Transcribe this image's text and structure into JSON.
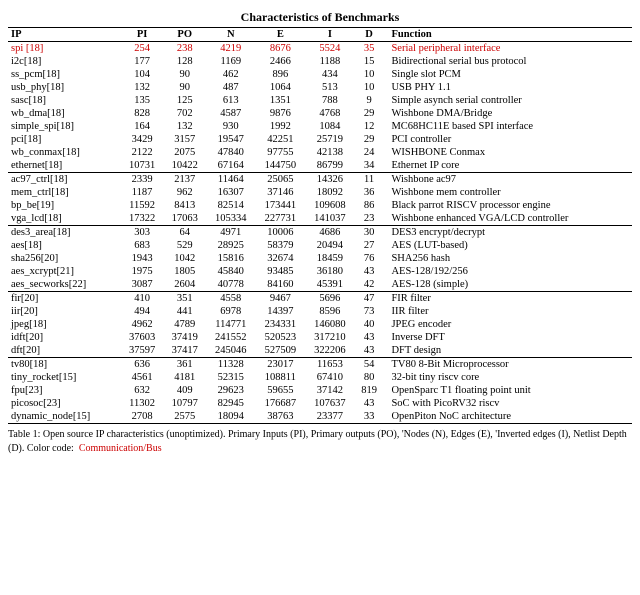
{
  "table": {
    "title": "Characteristics of Benchmarks",
    "headers": {
      "ip": "IP",
      "pi": "PI",
      "po": "PO",
      "n": "N",
      "e": "E",
      "i": "I",
      "d": "D",
      "function": "Function"
    },
    "groups": [
      {
        "rows": [
          {
            "ip": "spi [18]",
            "pi": "254",
            "po": "238",
            "n": "4219",
            "e": "8676",
            "i": "5524",
            "d": "35",
            "func": "Serial peripheral interface",
            "color": "comm"
          },
          {
            "ip": "i2c[18]",
            "pi": "177",
            "po": "128",
            "n": "1169",
            "e": "2466",
            "i": "1188",
            "d": "15",
            "func": "Bidirectional serial bus protocol",
            "color": ""
          },
          {
            "ip": "ss_pcm[18]",
            "pi": "104",
            "po": "90",
            "n": "462",
            "e": "896",
            "i": "434",
            "d": "10",
            "func": "Single slot PCM",
            "color": ""
          },
          {
            "ip": "usb_phy[18]",
            "pi": "132",
            "po": "90",
            "n": "487",
            "e": "1064",
            "i": "513",
            "d": "10",
            "func": "USB PHY 1.1",
            "color": ""
          },
          {
            "ip": "sasc[18]",
            "pi": "135",
            "po": "125",
            "n": "613",
            "e": "1351",
            "i": "788",
            "d": "9",
            "func": "Simple asynch serial controller",
            "color": ""
          },
          {
            "ip": "wb_dma[18]",
            "pi": "828",
            "po": "702",
            "n": "4587",
            "e": "9876",
            "i": "4768",
            "d": "29",
            "func": "Wishbone DMA/Bridge",
            "color": ""
          },
          {
            "ip": "simple_spi[18]",
            "pi": "164",
            "po": "132",
            "n": "930",
            "e": "1992",
            "i": "1084",
            "d": "12",
            "func": "MC68HC11E based SPI interface",
            "color": ""
          },
          {
            "ip": "pci[18]",
            "pi": "3429",
            "po": "3157",
            "n": "19547",
            "e": "42251",
            "i": "25719",
            "d": "29",
            "func": "PCI controller",
            "color": ""
          },
          {
            "ip": "wb_conmax[18]",
            "pi": "2122",
            "po": "2075",
            "n": "47840",
            "e": "97755",
            "i": "42138",
            "d": "24",
            "func": "WISHBONE Conmax",
            "color": ""
          },
          {
            "ip": "ethernet[18]",
            "pi": "10731",
            "po": "10422",
            "n": "67164",
            "e": "144750",
            "i": "86799",
            "d": "34",
            "func": "Ethernet IP core",
            "color": ""
          }
        ]
      },
      {
        "rows": [
          {
            "ip": "ac97_ctrl[18]",
            "pi": "2339",
            "po": "2137",
            "n": "11464",
            "e": "25065",
            "i": "14326",
            "d": "11",
            "func": "Wishbone ac97",
            "color": ""
          },
          {
            "ip": "mem_ctrl[18]",
            "pi": "1187",
            "po": "962",
            "n": "16307",
            "e": "37146",
            "i": "18092",
            "d": "36",
            "func": "Wishbone mem controller",
            "color": ""
          },
          {
            "ip": "bp_be[19]",
            "pi": "11592",
            "po": "8413",
            "n": "82514",
            "e": "173441",
            "i": "109608",
            "d": "86",
            "func": "Black parrot RISCV processor engine",
            "color": ""
          },
          {
            "ip": "vga_lcd[18]",
            "pi": "17322",
            "po": "17063",
            "n": "105334",
            "e": "227731",
            "i": "141037",
            "d": "23",
            "func": "Wishbone enhanced VGA/LCD controller",
            "color": ""
          }
        ]
      },
      {
        "rows": [
          {
            "ip": "des3_area[18]",
            "pi": "303",
            "po": "64",
            "n": "4971",
            "e": "10006",
            "i": "4686",
            "d": "30",
            "func": "DES3 encrypt/decrypt",
            "color": ""
          },
          {
            "ip": "aes[18]",
            "pi": "683",
            "po": "529",
            "n": "28925",
            "e": "58379",
            "i": "20494",
            "d": "27",
            "func": "AES (LUT-based)",
            "color": ""
          },
          {
            "ip": "sha256[20]",
            "pi": "1943",
            "po": "1042",
            "n": "15816",
            "e": "32674",
            "i": "18459",
            "d": "76",
            "func": "SHA256 hash",
            "color": ""
          },
          {
            "ip": "aes_xcrypt[21]",
            "pi": "1975",
            "po": "1805",
            "n": "45840",
            "e": "93485",
            "i": "36180",
            "d": "43",
            "func": "AES-128/192/256",
            "color": ""
          },
          {
            "ip": "aes_secworks[22]",
            "pi": "3087",
            "po": "2604",
            "n": "40778",
            "e": "84160",
            "i": "45391",
            "d": "42",
            "func": "AES-128 (simple)",
            "color": ""
          }
        ]
      },
      {
        "rows": [
          {
            "ip": "fir[20]",
            "pi": "410",
            "po": "351",
            "n": "4558",
            "e": "9467",
            "i": "5696",
            "d": "47",
            "func": "FIR filter",
            "color": ""
          },
          {
            "ip": "iir[20]",
            "pi": "494",
            "po": "441",
            "n": "6978",
            "e": "14397",
            "i": "8596",
            "d": "73",
            "func": "IIR filter",
            "color": ""
          },
          {
            "ip": "jpeg[18]",
            "pi": "4962",
            "po": "4789",
            "n": "114771",
            "e": "234331",
            "i": "146080",
            "d": "40",
            "func": "JPEG encoder",
            "color": ""
          },
          {
            "ip": "idft[20]",
            "pi": "37603",
            "po": "37419",
            "n": "241552",
            "e": "520523",
            "i": "317210",
            "d": "43",
            "func": "Inverse DFT",
            "color": ""
          },
          {
            "ip": "dft[20]",
            "pi": "37597",
            "po": "37417",
            "n": "245046",
            "e": "527509",
            "i": "322206",
            "d": "43",
            "func": "DFT design",
            "color": ""
          }
        ]
      },
      {
        "rows": [
          {
            "ip": "tv80[18]",
            "pi": "636",
            "po": "361",
            "n": "11328",
            "e": "23017",
            "i": "11653",
            "d": "54",
            "func": "TV80 8-Bit Microprocessor",
            "color": ""
          },
          {
            "ip": "tiny_rocket[15]",
            "pi": "4561",
            "po": "4181",
            "n": "52315",
            "e": "108811",
            "i": "67410",
            "d": "80",
            "func": "32-bit tiny riscv core",
            "color": ""
          },
          {
            "ip": "fpu[23]",
            "pi": "632",
            "po": "409",
            "n": "29623",
            "e": "59655",
            "i": "37142",
            "d": "819",
            "func": "OpenSparc T1 floating point unit",
            "color": ""
          },
          {
            "ip": "picosoc[23]",
            "pi": "11302",
            "po": "10797",
            "n": "82945",
            "e": "176687",
            "i": "107637",
            "d": "43",
            "func": "SoC with PicoRV32 riscv",
            "color": ""
          },
          {
            "ip": "dynamic_node[15]",
            "pi": "2708",
            "po": "2575",
            "n": "18094",
            "e": "38763",
            "i": "23377",
            "d": "33",
            "func": "OpenPiton NoC architecture",
            "color": ""
          }
        ]
      }
    ],
    "footer": "Table 1: Open source IP characteristics (unoptimized). Primary Inputs (PI), Primary outputs (PO), 'Nodes (N), Edges (E), 'Inverted edges (I), Netlist Depth (D). Color code:",
    "footer_comm": "Communication/Bus"
  }
}
